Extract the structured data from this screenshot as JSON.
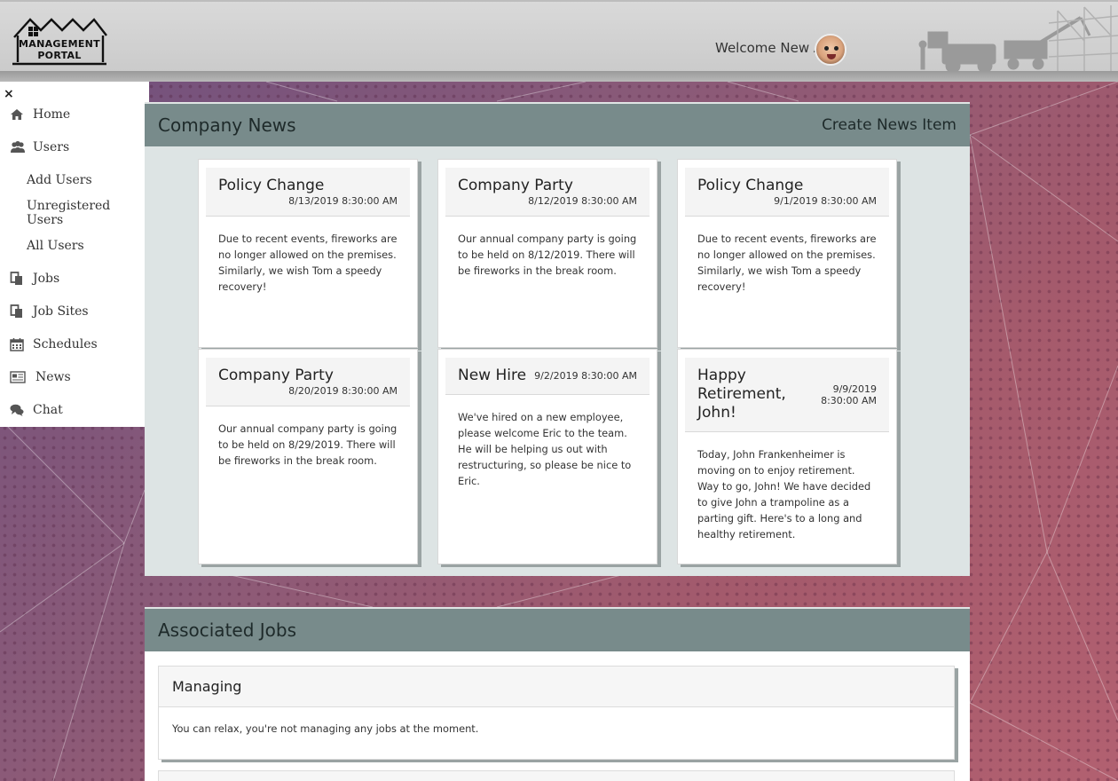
{
  "header": {
    "logo_line1": "MANAGEMENT",
    "logo_line2": "PORTAL",
    "welcome": "Welcome New A"
  },
  "sidebar": {
    "close": "×",
    "items": [
      {
        "label": "Home",
        "icon": "home-icon"
      },
      {
        "label": "Users",
        "icon": "users-icon"
      },
      {
        "label": "Add Users"
      },
      {
        "label": "Unregistered Users"
      },
      {
        "label": "All Users"
      },
      {
        "label": "Jobs",
        "icon": "copy-icon"
      },
      {
        "label": "Job Sites",
        "icon": "copy-icon"
      },
      {
        "label": "Schedules",
        "icon": "calendar-icon"
      },
      {
        "label": "News",
        "icon": "newspaper-icon"
      },
      {
        "label": "Chat",
        "icon": "comments-icon"
      }
    ]
  },
  "news": {
    "title": "Company News",
    "create_link": "Create News Item",
    "items": [
      {
        "title": "Policy Change",
        "date": "8/13/2019 8:30:00 AM",
        "body": "Due to recent events, fireworks are no longer allowed on the premises. Similarly, we wish Tom a speedy recovery!"
      },
      {
        "title": "Company Party",
        "date": "8/12/2019 8:30:00 AM",
        "body": "Our annual company party is going to be held on 8/12/2019. There will be fireworks in the break room."
      },
      {
        "title": "Policy Change",
        "date": "9/1/2019 8:30:00 AM",
        "body": "Due to recent events, fireworks are no longer allowed on the premises. Similarly, we wish Tom a speedy recovery!"
      },
      {
        "title": "Company Party",
        "date": "8/20/2019 8:30:00 AM",
        "body": "Our annual company party is going to be held on 8/29/2019. There will be fireworks in the break room."
      },
      {
        "title": "New Hire",
        "date": "9/2/2019 8:30:00 AM",
        "body": "We've hired on a new employee, please welcome Eric to the team. He will be helping us out with restructuring, so please be nice to Eric."
      },
      {
        "title": "Happy Retirement, John!",
        "date": "9/9/2019 8:30:00 AM",
        "body": "Today, John Frankenheimer is moving on to enjoy retirement. Way to go, John! We have decided to give John a trampoline as a parting gift. Here's to a long and healthy retirement."
      }
    ]
  },
  "jobs": {
    "title": "Associated Jobs",
    "managing_title": "Managing",
    "managing_text": "You can relax, you're not managing any jobs at the moment."
  }
}
